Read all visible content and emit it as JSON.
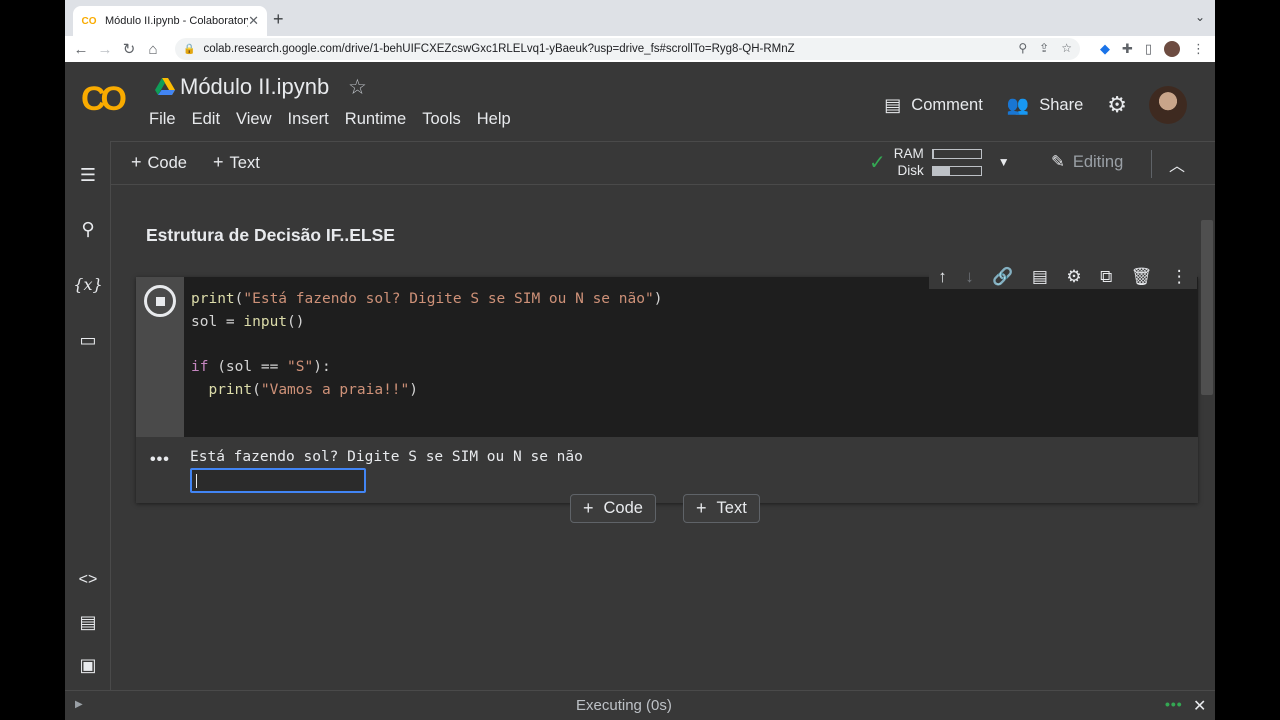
{
  "browser": {
    "tab_title": "Módulo II.ipynb - Colaboratory",
    "tab_favicon": "CO",
    "url": "colab.research.google.com/drive/1-behUIFCXEZcswGxc1RLELvq1-yBaeuk?usp=drive_fs#scrollTo=Ryg8-QH-RMnZ"
  },
  "header": {
    "logo": "CO",
    "notebook_title": "Módulo II.ipynb",
    "menu": [
      "File",
      "Edit",
      "View",
      "Insert",
      "Runtime",
      "Tools",
      "Help"
    ],
    "comment_label": "Comment",
    "share_label": "Share"
  },
  "subbar": {
    "add_code_label": "Code",
    "add_text_label": "Text",
    "ram_label": "RAM",
    "disk_label": "Disk",
    "ram_usage": 0.03,
    "disk_usage": 0.35,
    "editing_label": "Editing"
  },
  "notebook": {
    "section_title": "Estrutura de Decisão IF..ELSE",
    "code_lines": [
      "print(\"Está fazendo sol? Digite S se SIM ou N se não\")",
      "sol = input()",
      "",
      "if (sol == \"S\"):",
      "  print(\"Vamos a praia!!\")"
    ],
    "output_text": "Está fazendo sol? Digite S se SIM ou N se não",
    "input_value": "",
    "add_code_label": "Code",
    "add_text_label": "Text"
  },
  "status": {
    "message": "Executing (0s)"
  },
  "colors": {
    "accent": "#f9ab00",
    "success": "#34a853",
    "focus": "#4285f4"
  }
}
